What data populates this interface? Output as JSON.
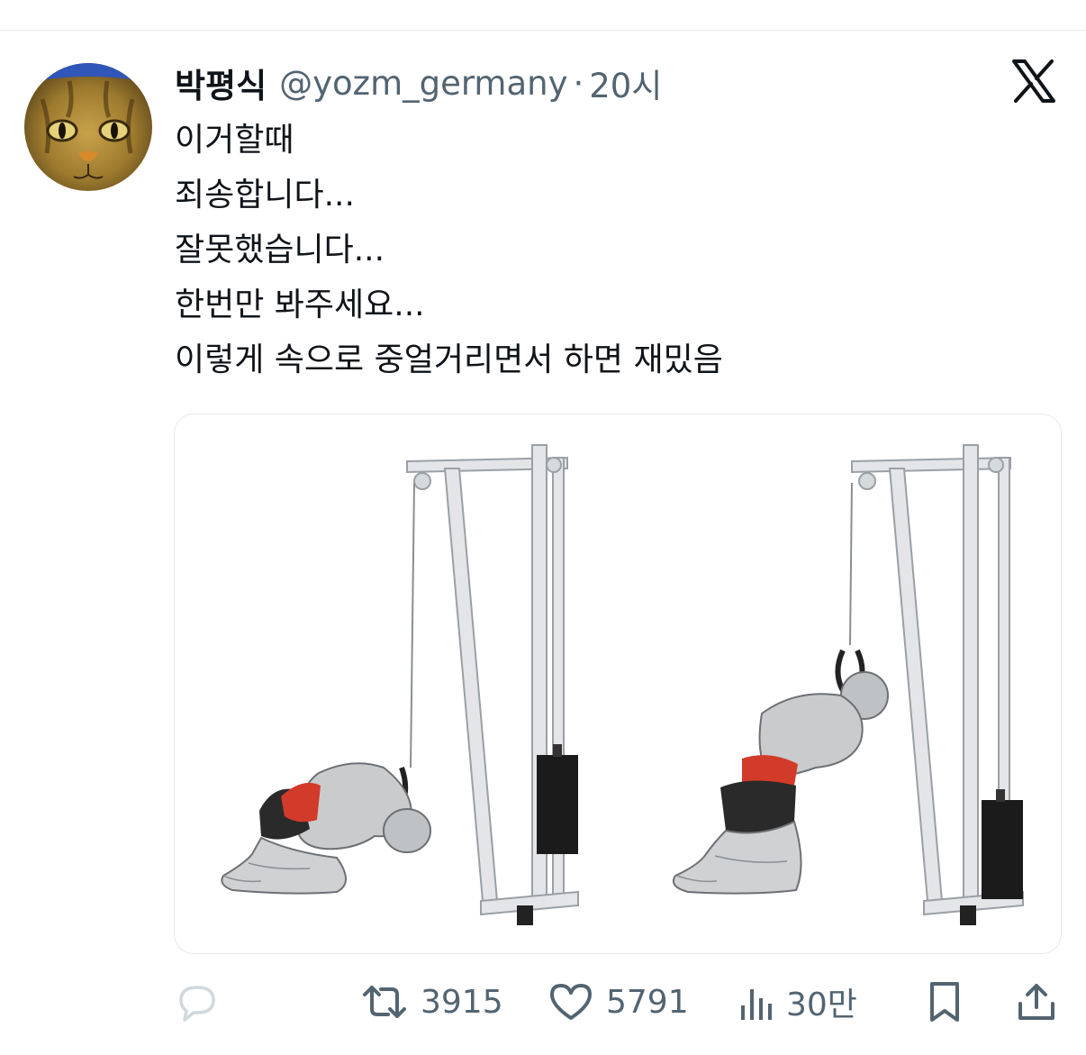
{
  "tweet": {
    "display_name": "박평식",
    "handle": "@yozm_germany",
    "separator": "·",
    "time": "20시",
    "lines": [
      "이거할때",
      "죄송합니다...",
      "잘못했습니다...",
      "한번만 봐주세요...",
      "이렇게 속으로 중얼거리면서 하면 재밌음"
    ]
  },
  "media": {
    "description_icon": "exercise-illustration",
    "muscle_color": "#d23a2a"
  },
  "actions": {
    "reply_icon": "reply-icon",
    "retweet_count": "3915",
    "like_count": "5791",
    "views_count": "30만",
    "bookmark_icon": "bookmark-icon",
    "share_icon": "share-icon"
  },
  "colors": {
    "text": "#0f1419",
    "secondary": "#536471",
    "reply_faded": "#cfd9de"
  }
}
